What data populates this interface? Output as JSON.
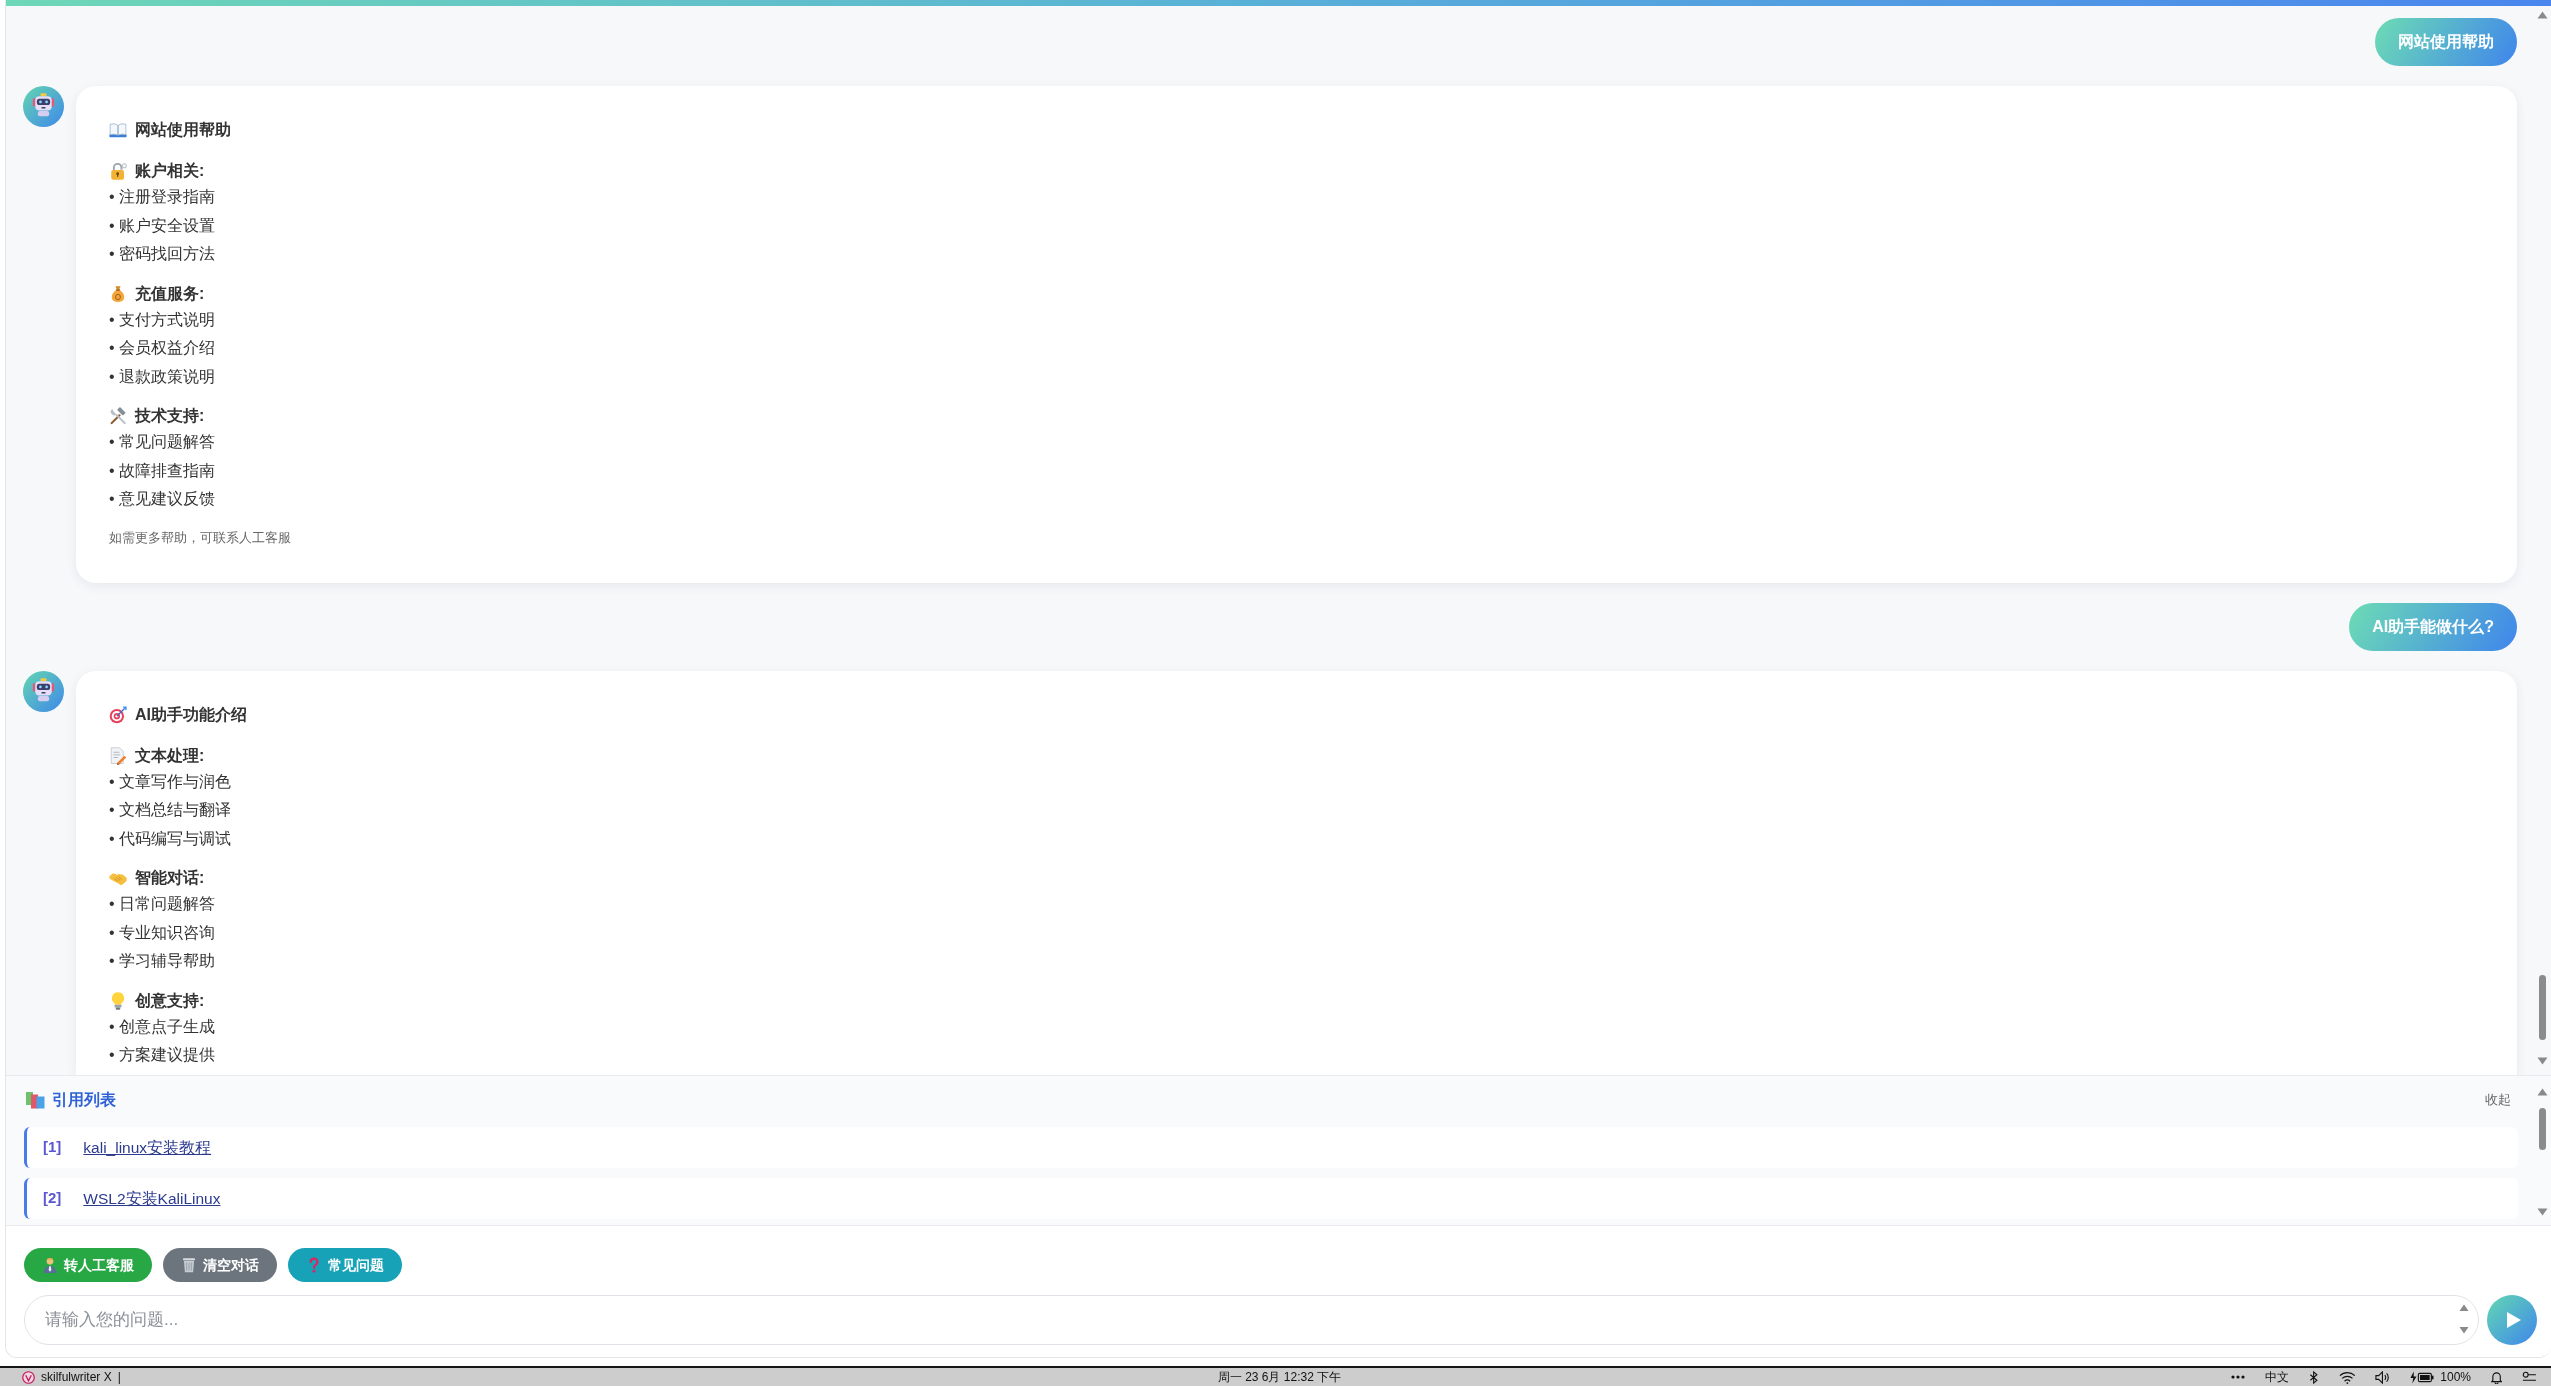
{
  "messages": [
    {
      "kind": "user",
      "text": "网站使用帮助"
    },
    {
      "kind": "assistant",
      "title": {
        "kind": "help",
        "text": "网站使用帮助"
      },
      "sections": [
        {
          "kind": "account",
          "heading": "账户相关:",
          "items": [
            "• 注册登录指南",
            "• 账户安全设置",
            "• 密码找回方法"
          ]
        },
        {
          "kind": "recharge",
          "heading": "充值服务:",
          "items": [
            "• 支付方式说明",
            "• 会员权益介绍",
            "• 退款政策说明"
          ]
        },
        {
          "kind": "support",
          "heading": "技术支持:",
          "items": [
            "• 常见问题解答",
            "• 故障排查指南",
            "• 意见建议反馈"
          ]
        }
      ],
      "footnote": "如需更多帮助，可联系人工客服"
    },
    {
      "kind": "user",
      "text": "AI助手能做什么?"
    },
    {
      "kind": "assistant",
      "title": {
        "kind": "features",
        "text": "AI助手功能介绍"
      },
      "sections": [
        {
          "kind": "writing",
          "heading": "文本处理:",
          "items": [
            "• 文章写作与润色",
            "• 文档总结与翻译",
            "• 代码编写与调试"
          ]
        },
        {
          "kind": "dialogue",
          "heading": "智能对话:",
          "items": [
            "• 日常问题解答",
            "• 专业知识咨询",
            "• 学习辅导帮助"
          ]
        },
        {
          "kind": "creative",
          "heading": "创意支持:",
          "items": [
            "• 创意点子生成",
            "• 方案建议提供"
          ]
        }
      ]
    }
  ],
  "citations": {
    "title": "引用列表",
    "toggle": "收起",
    "items": [
      {
        "number": "[1]",
        "title": "kali_linux安装教程"
      },
      {
        "number": "[2]",
        "title": "WSL2安装KaliLinux"
      }
    ]
  },
  "quick_actions": [
    {
      "kind": "agent",
      "label": "转人工客服"
    },
    {
      "kind": "clear",
      "label": "清空对话"
    },
    {
      "kind": "faq",
      "label": "常见问题"
    }
  ],
  "input": {
    "placeholder": "请输入您的问题..."
  },
  "taskbar": {
    "app_title": "skilfulwriter X",
    "separator": "|",
    "clock": "周一 23 6月 12:32 下午",
    "input_method": "中文",
    "battery": "100%"
  }
}
